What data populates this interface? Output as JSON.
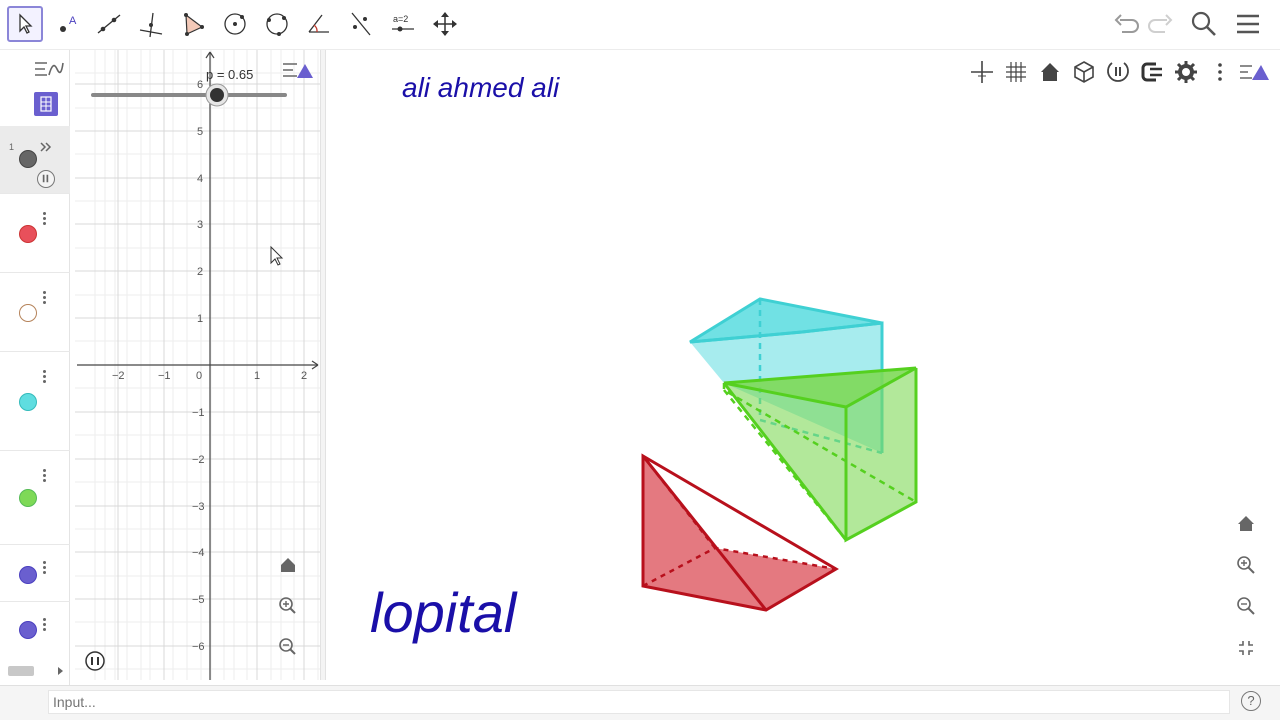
{
  "toolbar": {
    "tools": [
      {
        "name": "move-tool",
        "icon": "arrow-pointer-icon"
      },
      {
        "name": "point-tool",
        "icon": "point-icon"
      },
      {
        "name": "line-tool",
        "icon": "line-icon"
      },
      {
        "name": "perpendicular-tool",
        "icon": "perpendicular-icon"
      },
      {
        "name": "polygon-tool",
        "icon": "polygon-icon"
      },
      {
        "name": "circle-center-tool",
        "icon": "circle-center-icon"
      },
      {
        "name": "circle-three-points-tool",
        "icon": "circle-three-points-icon"
      },
      {
        "name": "angle-tool",
        "icon": "angle-icon"
      },
      {
        "name": "reflect-tool",
        "icon": "reflect-icon"
      },
      {
        "name": "slider-tool",
        "icon": "slider-icon",
        "label": "a=2"
      },
      {
        "name": "move-graphics-tool",
        "icon": "move-arrows-icon"
      }
    ],
    "right": [
      "undo-icon",
      "redo-icon",
      "search-icon",
      "menu-icon"
    ]
  },
  "algebra": {
    "rows": [
      {
        "type": "slider-object",
        "color": "#666666",
        "label": "1"
      },
      {
        "type": "object",
        "color": "#e8505b"
      },
      {
        "type": "object",
        "color": "#ffffff",
        "outline": "#b5835a"
      },
      {
        "type": "object",
        "color": "#5fdde0"
      },
      {
        "type": "object",
        "color": "#7ed957"
      },
      {
        "type": "object",
        "color": "#6a5fcf"
      },
      {
        "type": "object",
        "color": "#6a5fcf"
      }
    ]
  },
  "graphics2d": {
    "slider_label": "p = 0.65",
    "slider_value": 0.65,
    "x_ticks": [
      "−2",
      "−1",
      "0",
      "1",
      "2"
    ],
    "y_ticks_pos": [
      "6",
      "5",
      "4",
      "3",
      "2",
      "1"
    ],
    "y_ticks_neg": [
      "−1",
      "−2",
      "−3",
      "−4",
      "−5",
      "−6"
    ]
  },
  "graphics3d": {
    "author_text": "ali ahmed ali",
    "big_text": "lopital",
    "colors": {
      "cyan": "#5fdde0",
      "green": "#7ed957",
      "red": "#d9404a",
      "text": "#1a0fa8"
    }
  },
  "input": {
    "placeholder": "Input..."
  }
}
